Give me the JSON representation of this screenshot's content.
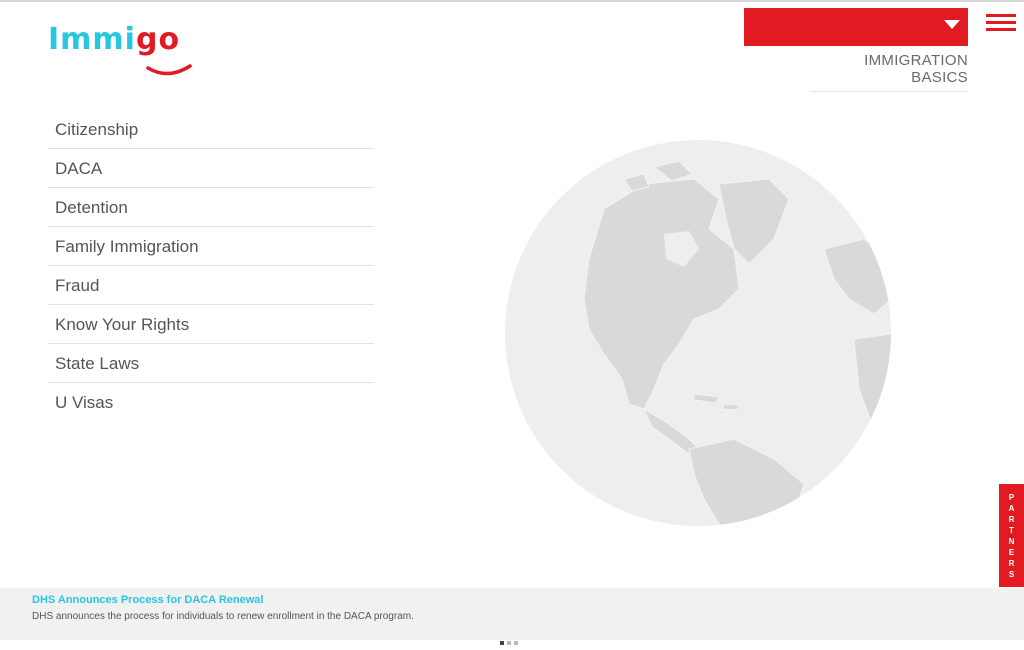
{
  "brand": {
    "part1": "Immi",
    "part2": "go",
    "colors": {
      "cyan": "#27c6e3",
      "red": "#e21b23"
    }
  },
  "header": {
    "language_selected": "",
    "section_title": "IMMIGRATION BASICS",
    "menu_icon": "hamburger-icon",
    "dropdown_icon": "caret-down-icon"
  },
  "topics": [
    "Citizenship",
    "DACA",
    "Detention",
    "Family Immigration",
    "Fraud",
    "Know Your Rights",
    "State Laws",
    "U Visas"
  ],
  "partners_tab": {
    "label": "PARTNERS"
  },
  "news": {
    "title": "DHS Announces Process for DACA Renewal",
    "description": "DHS announces the process for individuals to renew enrollment in the DACA program.",
    "page_count": 3,
    "active_page": 1
  }
}
